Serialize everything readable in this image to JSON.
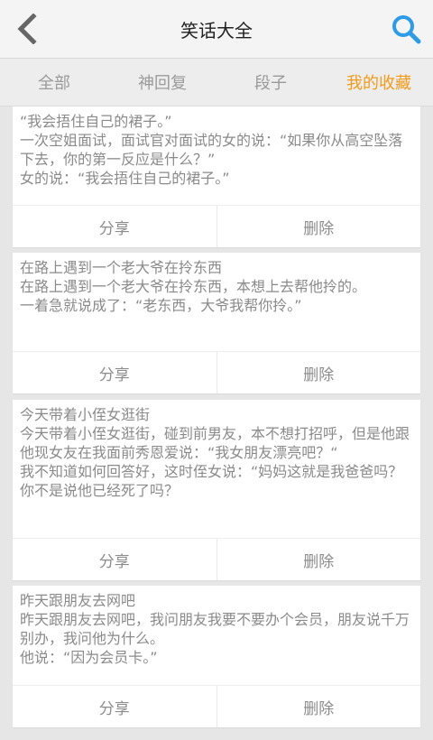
{
  "header": {
    "title": "笑话大全",
    "back_icon": "chevron-left-icon",
    "search_icon": "search-icon",
    "accent_color": "#2d9be5"
  },
  "tabs": [
    {
      "label": "全部"
    },
    {
      "label": "神回复"
    },
    {
      "label": "段子"
    },
    {
      "label": "我的收藏"
    }
  ],
  "active_tab_color": "#f29a1a",
  "cards": [
    {
      "title": "“我会捂住自己的裙子。”",
      "text": "一次空姐面试，面试官对面试的女的说：“如果你从高空坠落下去，你的第一反应是什么？”\n女的说：“我会捂住自己的裙子。”",
      "share": "分享",
      "delete": "删除"
    },
    {
      "title": "在路上遇到一个老大爷在拎东西",
      "text": "在路上遇到一个老大爷在拎东西，本想上去帮他拎的。\n一着急就说成了：“老东西，大爷我帮你拎。”",
      "share": "分享",
      "delete": "删除"
    },
    {
      "title": "今天带着小侄女逛街",
      "text": "今天带着小侄女逛街，碰到前男友，本不想打招呼，但是他跟他现女友在我面前秀恩爱说：“我女朋友漂亮吧？“\n我不知道如何回答好，这时侄女说：“妈妈这就是我爸爸吗？你不是说他已经死了吗？",
      "share": "分享",
      "delete": "删除"
    },
    {
      "title": "昨天跟朋友去网吧",
      "text": "昨天跟朋友去网吧，我问朋友我要不要办个会员，朋友说千万别办，我问他为什么。\n他说：“因为会员卡。”",
      "share": "分享",
      "delete": "删除"
    }
  ]
}
